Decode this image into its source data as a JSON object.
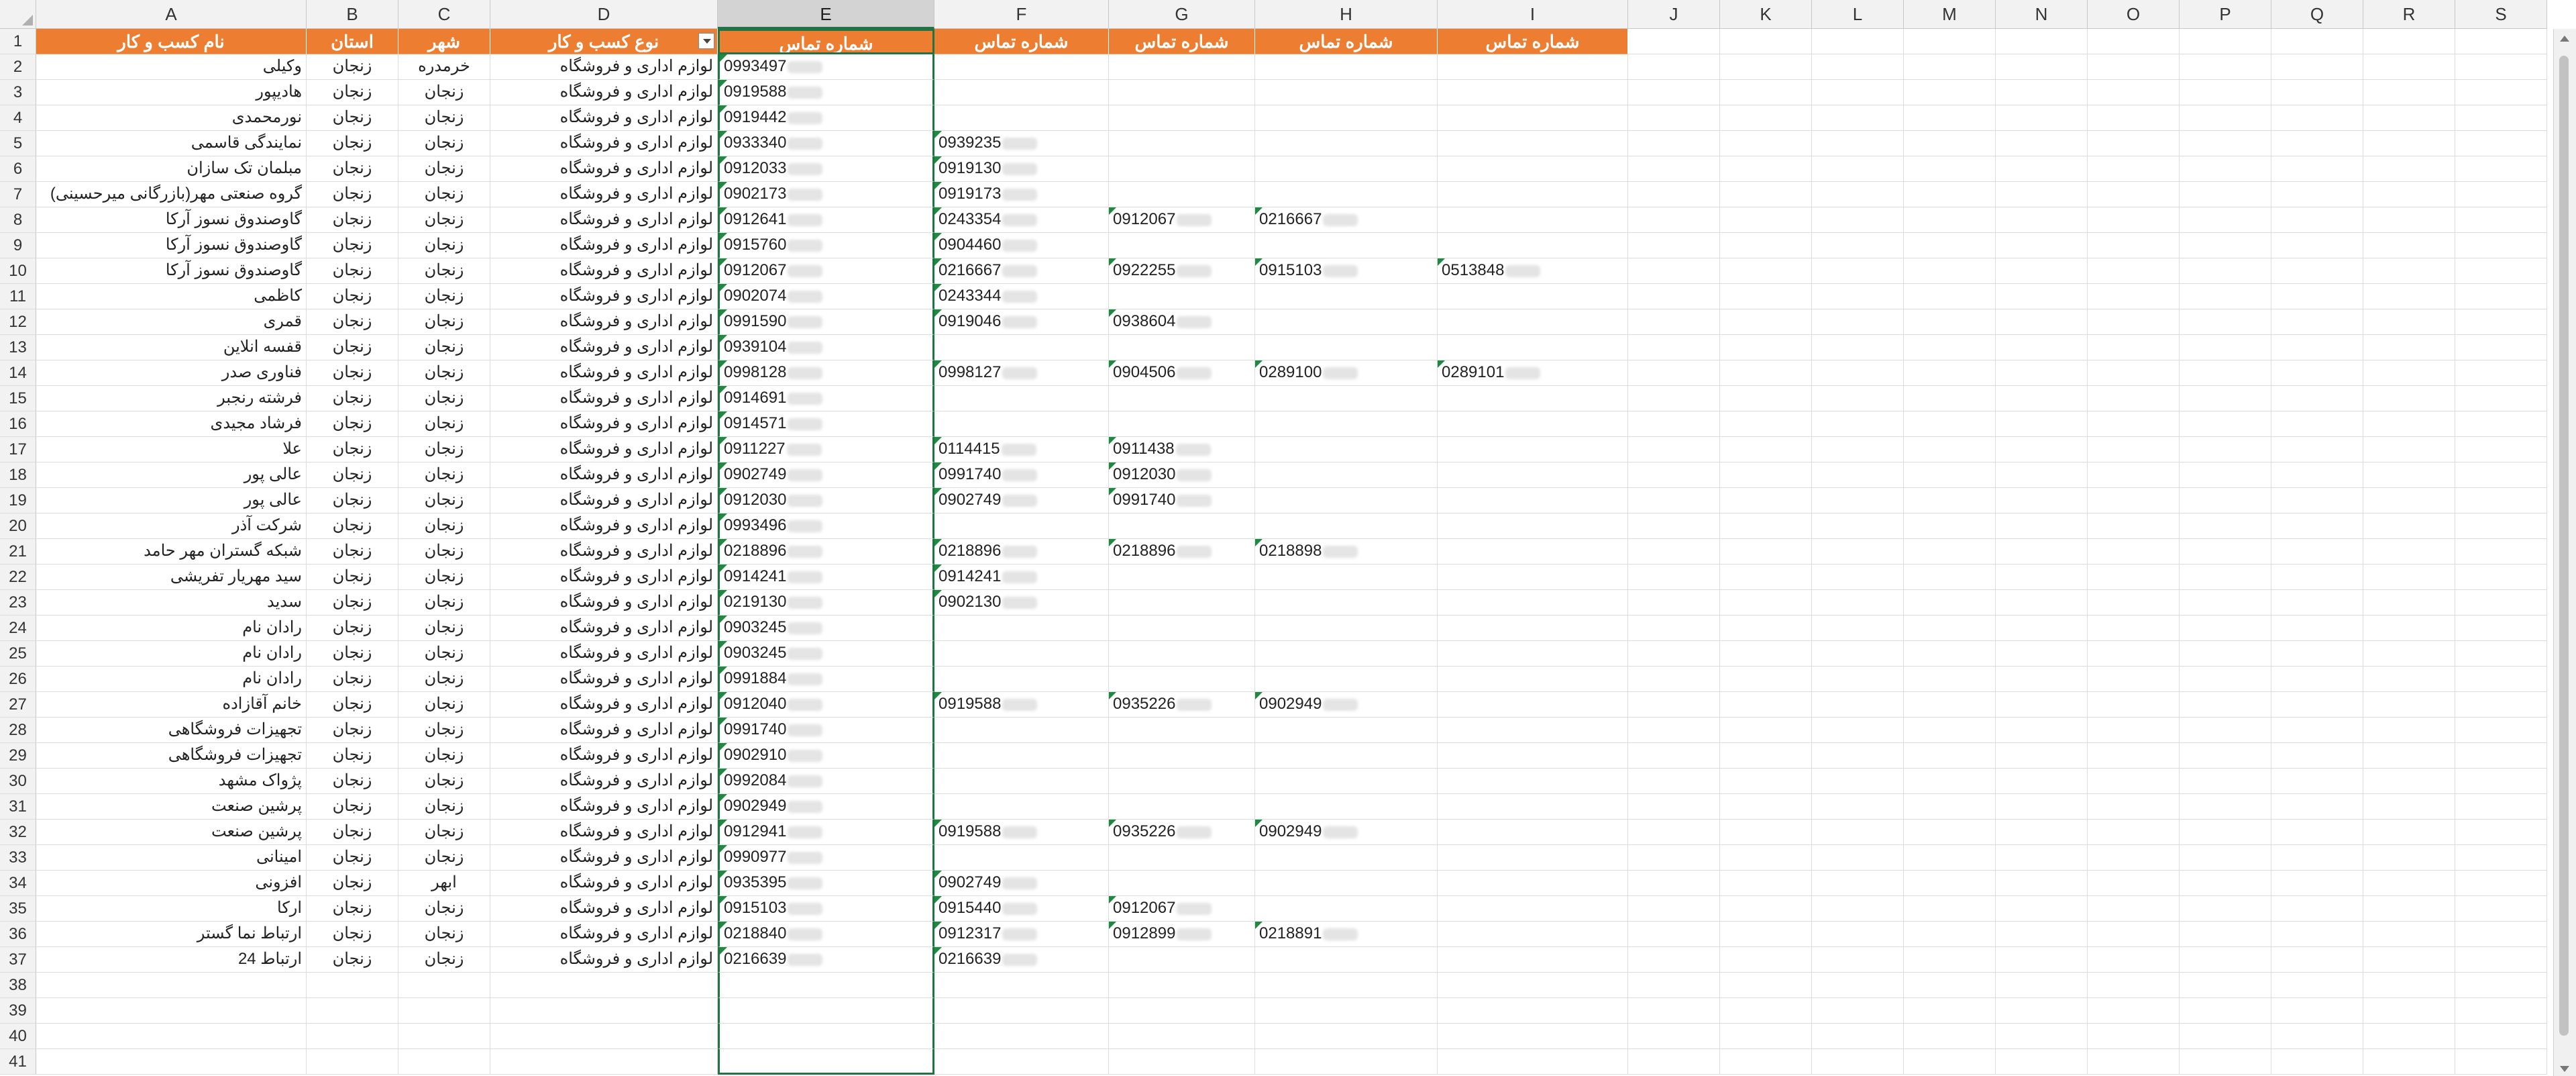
{
  "column_letters": [
    "A",
    "B",
    "C",
    "D",
    "E",
    "F",
    "G",
    "H",
    "I",
    "J",
    "K",
    "L",
    "M",
    "N",
    "O",
    "P",
    "Q",
    "R",
    "S"
  ],
  "selected_column": "E",
  "header_row": [
    "نام کسب و کار",
    "استان",
    "شهر",
    "نوع کسب و کار",
    "شماره تماس",
    "شماره تماس",
    "شماره تماس",
    "شماره تماس",
    "شماره تماس"
  ],
  "rows": [
    {
      "r": "2",
      "a": "وکیلی",
      "b": "زنجان",
      "c": "خرمدره",
      "d": "لوازم اداری و فروشگاه",
      "e": "0993497",
      "f": "",
      "g": "",
      "h": "",
      "i": ""
    },
    {
      "r": "3",
      "a": "هادیپور",
      "b": "زنجان",
      "c": "زنجان",
      "d": "لوازم اداری و فروشگاه",
      "e": "0919588",
      "f": "",
      "g": "",
      "h": "",
      "i": ""
    },
    {
      "r": "4",
      "a": "نورمحمدی",
      "b": "زنجان",
      "c": "زنجان",
      "d": "لوازم اداری و فروشگاه",
      "e": "0919442",
      "f": "",
      "g": "",
      "h": "",
      "i": ""
    },
    {
      "r": "5",
      "a": "نمایندگی قاسمی",
      "b": "زنجان",
      "c": "زنجان",
      "d": "لوازم اداری و فروشگاه",
      "e": "0933340",
      "f": "0939235",
      "g": "",
      "h": "",
      "i": ""
    },
    {
      "r": "6",
      "a": "مبلمان تک سازان",
      "b": "زنجان",
      "c": "زنجان",
      "d": "لوازم اداری و فروشگاه",
      "e": "0912033",
      "f": "0919130",
      "g": "",
      "h": "",
      "i": ""
    },
    {
      "r": "7",
      "a": "گروه صنعتی مهر(بازرگانی میرحسینی)",
      "b": "زنجان",
      "c": "زنجان",
      "d": "لوازم اداری و فروشگاه",
      "e": "0902173",
      "f": "0919173",
      "g": "",
      "h": "",
      "i": ""
    },
    {
      "r": "8",
      "a": "گاوصندوق نسوز آرکا",
      "b": "زنجان",
      "c": "زنجان",
      "d": "لوازم اداری و فروشگاه",
      "e": "0912641",
      "f": "0243354",
      "g": "0912067",
      "h": "0216667",
      "i": ""
    },
    {
      "r": "9",
      "a": "گاوصندوق نسوز آرکا",
      "b": "زنجان",
      "c": "زنجان",
      "d": "لوازم اداری و فروشگاه",
      "e": "0915760",
      "f": "0904460",
      "g": "",
      "h": "",
      "i": ""
    },
    {
      "r": "10",
      "a": "گاوصندوق نسوز آرکا",
      "b": "زنجان",
      "c": "زنجان",
      "d": "لوازم اداری و فروشگاه",
      "e": "0912067",
      "f": "0216667",
      "g": "0922255",
      "h": "0915103",
      "i": "0513848"
    },
    {
      "r": "11",
      "a": "کاظمی",
      "b": "زنجان",
      "c": "زنجان",
      "d": "لوازم اداری و فروشگاه",
      "e": "0902074",
      "f": "0243344",
      "g": "",
      "h": "",
      "i": ""
    },
    {
      "r": "12",
      "a": "قمری",
      "b": "زنجان",
      "c": "زنجان",
      "d": "لوازم اداری و فروشگاه",
      "e": "0991590",
      "f": "0919046",
      "g": "0938604",
      "h": "",
      "i": ""
    },
    {
      "r": "13",
      "a": "قفسه انلاین",
      "b": "زنجان",
      "c": "زنجان",
      "d": "لوازم اداری و فروشگاه",
      "e": "0939104",
      "f": "",
      "g": "",
      "h": "",
      "i": ""
    },
    {
      "r": "14",
      "a": "فناوری صدر",
      "b": "زنجان",
      "c": "زنجان",
      "d": "لوازم اداری و فروشگاه",
      "e": "0998128",
      "f": "0998127",
      "g": "0904506",
      "h": "0289100",
      "i": "0289101"
    },
    {
      "r": "15",
      "a": "فرشته رنجبر",
      "b": "زنجان",
      "c": "زنجان",
      "d": "لوازم اداری و فروشگاه",
      "e": "0914691",
      "f": "",
      "g": "",
      "h": "",
      "i": ""
    },
    {
      "r": "16",
      "a": "فرشاد مجیدی",
      "b": "زنجان",
      "c": "زنجان",
      "d": "لوازم اداری و فروشگاه",
      "e": "0914571",
      "f": "",
      "g": "",
      "h": "",
      "i": ""
    },
    {
      "r": "17",
      "a": "علا",
      "b": "زنجان",
      "c": "زنجان",
      "d": "لوازم اداری و فروشگاه",
      "e": "0911227",
      "f": "0114415",
      "g": "0911438",
      "h": "",
      "i": ""
    },
    {
      "r": "18",
      "a": "عالی پور",
      "b": "زنجان",
      "c": "زنجان",
      "d": "لوازم اداری و فروشگاه",
      "e": "0902749",
      "f": "0991740",
      "g": "0912030",
      "h": "",
      "i": ""
    },
    {
      "r": "19",
      "a": "عالی پور",
      "b": "زنجان",
      "c": "زنجان",
      "d": "لوازم اداری و فروشگاه",
      "e": "0912030",
      "f": "0902749",
      "g": "0991740",
      "h": "",
      "i": ""
    },
    {
      "r": "20",
      "a": "شرکت آذر",
      "b": "زنجان",
      "c": "زنجان",
      "d": "لوازم اداری و فروشگاه",
      "e": "0993496",
      "f": "",
      "g": "",
      "h": "",
      "i": ""
    },
    {
      "r": "21",
      "a": "شبکه گستران مهر حامد",
      "b": "زنجان",
      "c": "زنجان",
      "d": "لوازم اداری و فروشگاه",
      "e": "0218896",
      "f": "0218896",
      "g": "0218896",
      "h": "0218898",
      "i": ""
    },
    {
      "r": "22",
      "a": "سید مهریار تفریشی",
      "b": "زنجان",
      "c": "زنجان",
      "d": "لوازم اداری و فروشگاه",
      "e": "0914241",
      "f": "0914241",
      "g": "",
      "h": "",
      "i": ""
    },
    {
      "r": "23",
      "a": "سدید",
      "b": "زنجان",
      "c": "زنجان",
      "d": "لوازم اداری و فروشگاه",
      "e": "0219130",
      "f": "0902130",
      "g": "",
      "h": "",
      "i": ""
    },
    {
      "r": "24",
      "a": "رادان نام",
      "b": "زنجان",
      "c": "زنجان",
      "d": "لوازم اداری و فروشگاه",
      "e": "0903245",
      "f": "",
      "g": "",
      "h": "",
      "i": ""
    },
    {
      "r": "25",
      "a": "رادان نام",
      "b": "زنجان",
      "c": "زنجان",
      "d": "لوازم اداری و فروشگاه",
      "e": "0903245",
      "f": "",
      "g": "",
      "h": "",
      "i": ""
    },
    {
      "r": "26",
      "a": "رادان نام",
      "b": "زنجان",
      "c": "زنجان",
      "d": "لوازم اداری و فروشگاه",
      "e": "0991884",
      "f": "",
      "g": "",
      "h": "",
      "i": ""
    },
    {
      "r": "27",
      "a": "خانم آقازاده",
      "b": "زنجان",
      "c": "زنجان",
      "d": "لوازم اداری و فروشگاه",
      "e": "0912040",
      "f": "0919588",
      "g": "0935226",
      "h": "0902949",
      "i": ""
    },
    {
      "r": "28",
      "a": "تجهیزات فروشگاهی",
      "b": "زنجان",
      "c": "زنجان",
      "d": "لوازم اداری و فروشگاه",
      "e": "0991740",
      "f": "",
      "g": "",
      "h": "",
      "i": ""
    },
    {
      "r": "29",
      "a": "تجهیزات فروشگاهی",
      "b": "زنجان",
      "c": "زنجان",
      "d": "لوازم اداری و فروشگاه",
      "e": "0902910",
      "f": "",
      "g": "",
      "h": "",
      "i": ""
    },
    {
      "r": "30",
      "a": "پژواک مشهد",
      "b": "زنجان",
      "c": "زنجان",
      "d": "لوازم اداری و فروشگاه",
      "e": "0992084",
      "f": "",
      "g": "",
      "h": "",
      "i": ""
    },
    {
      "r": "31",
      "a": "پرشین صنعت",
      "b": "زنجان",
      "c": "زنجان",
      "d": "لوازم اداری و فروشگاه",
      "e": "0902949",
      "f": "",
      "g": "",
      "h": "",
      "i": ""
    },
    {
      "r": "32",
      "a": "پرشین صنعت",
      "b": "زنجان",
      "c": "زنجان",
      "d": "لوازم اداری و فروشگاه",
      "e": "0912941",
      "f": "0919588",
      "g": "0935226",
      "h": "0902949",
      "i": ""
    },
    {
      "r": "33",
      "a": "امینانی",
      "b": "زنجان",
      "c": "زنجان",
      "d": "لوازم اداری و فروشگاه",
      "e": "0990977",
      "f": "",
      "g": "",
      "h": "",
      "i": ""
    },
    {
      "r": "34",
      "a": "افزونی",
      "b": "زنجان",
      "c": "ابهر",
      "d": "لوازم اداری و فروشگاه",
      "e": "0935395",
      "f": "0902749",
      "g": "",
      "h": "",
      "i": ""
    },
    {
      "r": "35",
      "a": "ارکا",
      "b": "زنجان",
      "c": "زنجان",
      "d": "لوازم اداری و فروشگاه",
      "e": "0915103",
      "f": "0915440",
      "g": "0912067",
      "h": "",
      "i": ""
    },
    {
      "r": "36",
      "a": "ارتباط نما گستر",
      "b": "زنجان",
      "c": "زنجان",
      "d": "لوازم اداری و فروشگاه",
      "e": "0218840",
      "f": "0912317",
      "g": "0912899",
      "h": "0218891",
      "i": ""
    },
    {
      "r": "37",
      "a": "ارتباط 24",
      "b": "زنجان",
      "c": "زنجان",
      "d": "لوازم اداری و فروشگاه",
      "e": "0216639",
      "f": "0216639",
      "g": "",
      "h": "",
      "i": ""
    }
  ],
  "empty_row_numbers": [
    "38",
    "39",
    "40",
    "41"
  ],
  "colors": {
    "header_fill": "#ed7d31",
    "header_text": "#ffffff",
    "selection": "#217346",
    "gridline": "#dadcdf"
  }
}
